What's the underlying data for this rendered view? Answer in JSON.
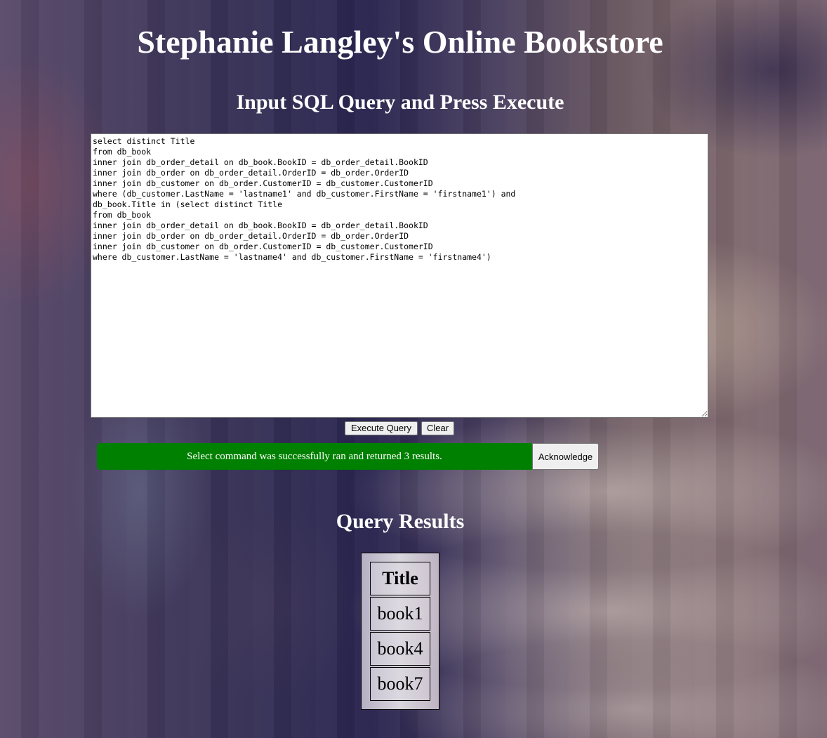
{
  "header": {
    "title": "Stephanie Langley's Online Bookstore",
    "subtitle": "Input SQL Query and Press Execute"
  },
  "query": {
    "text": "select distinct Title\nfrom db_book\ninner join db_order_detail on db_book.BookID = db_order_detail.BookID\ninner join db_order on db_order_detail.OrderID = db_order.OrderID\ninner join db_customer on db_order.CustomerID = db_customer.CustomerID\nwhere (db_customer.LastName = 'lastname1' and db_customer.FirstName = 'firstname1') and\ndb_book.Title in (select distinct Title\nfrom db_book\ninner join db_order_detail on db_book.BookID = db_order_detail.BookID\ninner join db_order on db_order_detail.OrderID = db_order.OrderID\ninner join db_customer on db_order.CustomerID = db_customer.CustomerID\nwhere db_customer.LastName = 'lastname4' and db_customer.FirstName = 'firstname4')"
  },
  "buttons": {
    "execute_label": "Execute Query",
    "clear_label": "Clear",
    "acknowledge_label": "Acknowledge"
  },
  "status": {
    "message": "Select command was successfully ran and returned 3 results.",
    "color": "#008000"
  },
  "results": {
    "heading": "Query Results",
    "columns": [
      "Title"
    ],
    "rows": [
      [
        "book1"
      ],
      [
        "book4"
      ],
      [
        "book7"
      ]
    ]
  }
}
